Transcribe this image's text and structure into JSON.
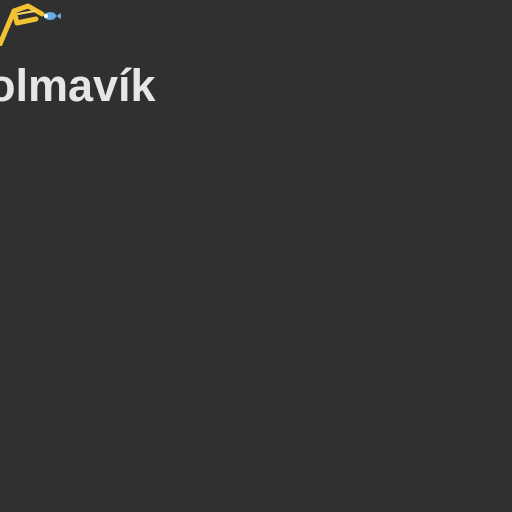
{
  "header": {
    "logo_icon": "fishing-rod-logo-icon",
    "title": "olmavík"
  },
  "colors": {
    "background": "#303030",
    "title_text": "#e6e6e6",
    "logo_primary": "#f1c232",
    "logo_accent": "#6aa9e6"
  }
}
